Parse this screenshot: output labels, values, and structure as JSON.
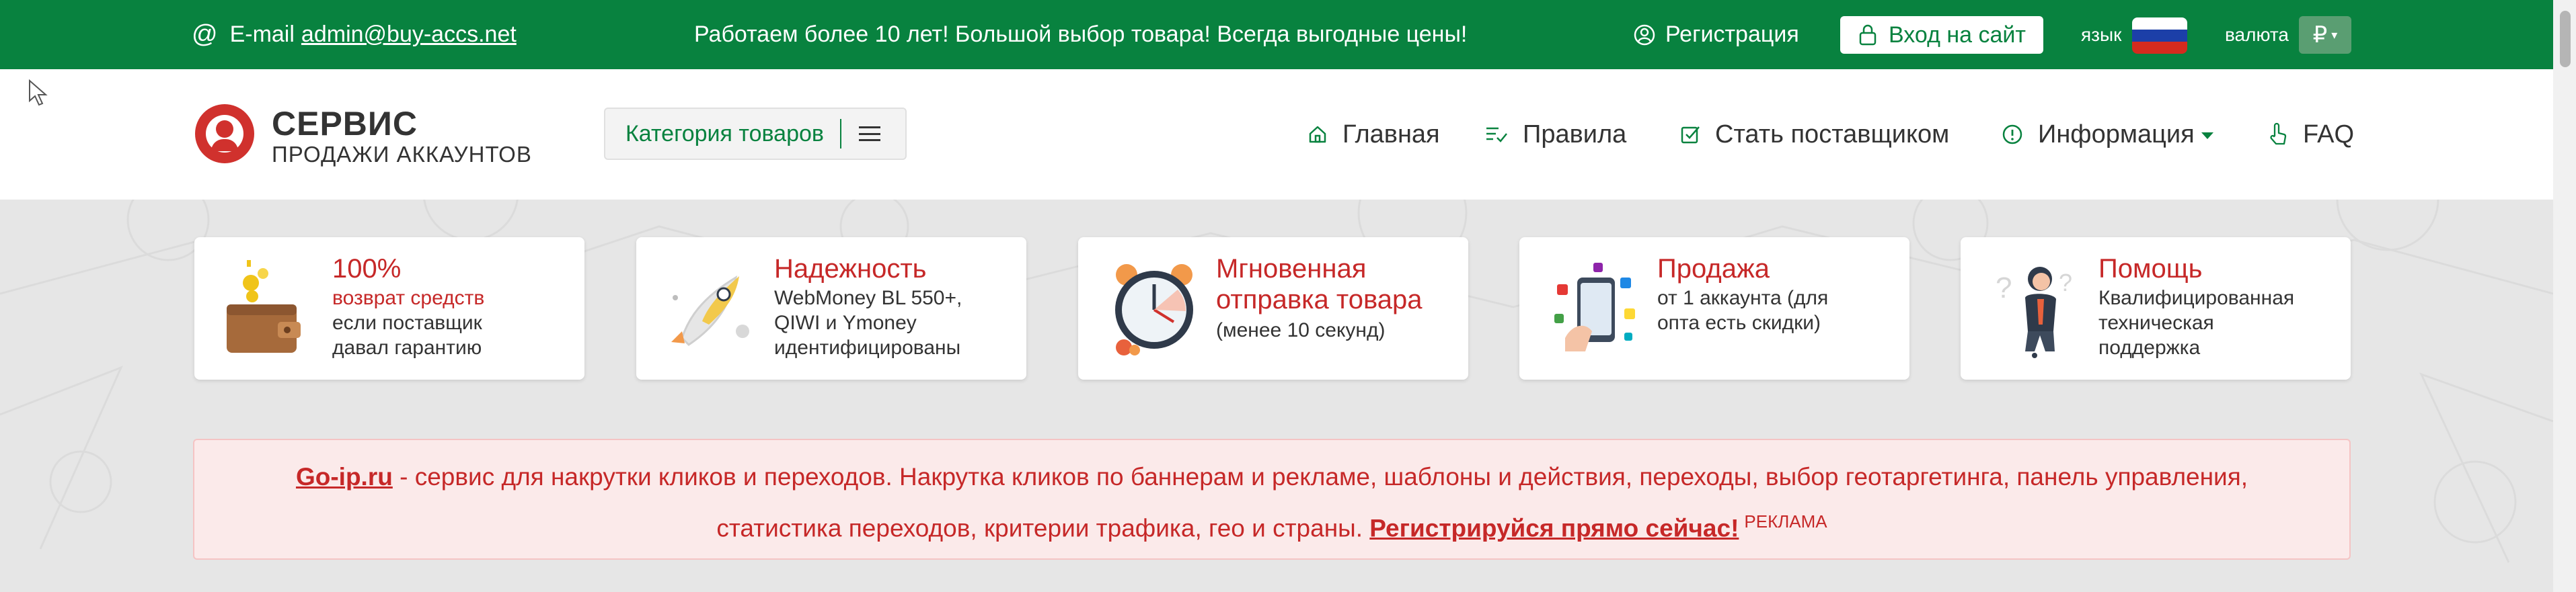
{
  "topbar": {
    "email_label": "E-mail",
    "email": "admin@buy-accs.net",
    "slogan": "Работаем более 10 лет! Большой выбор товара! Всегда выгодные цены!",
    "register": "Регистрация",
    "login": "Вход на сайт",
    "language_label": "язык",
    "currency_label": "валюта",
    "currency_symbol": "₽"
  },
  "header": {
    "logo_title": "СЕРВИС",
    "logo_subtitle": "ПРОДАЖИ АККАУНТОВ",
    "category_button": "Категория товаров",
    "nav": {
      "home": "Главная",
      "rules": "Правила",
      "supplier": "Стать поставщиком",
      "info": "Информация",
      "faq": "FAQ"
    }
  },
  "features": [
    {
      "title": "100%",
      "line1": "возврат средств",
      "line2": "если поставщик",
      "line3": "давал гарантию"
    },
    {
      "title": "Надежность",
      "line1": "WebMoney BL 550+,",
      "line2": "QIWI и Ymoney",
      "line3": "идентифицированы"
    },
    {
      "title_line1": "Мгновенная",
      "title_line2": "отправка товара",
      "line1": "(менее 10 секунд)"
    },
    {
      "title": "Продажа",
      "line1": "от 1 аккаунта (для",
      "line2": "опта есть скидки)"
    },
    {
      "title": "Помощь",
      "line1": "Квалифицированная",
      "line2": "техническая",
      "line3": "поддержка"
    }
  ],
  "ad": {
    "link": "Go-ip.ru",
    "text1": " - сервис для накрутки кликов и переходов. Накрутка кликов по баннерам и рекламе, шаблоны и действия, переходы, выбор геотаргетинга, панель управления,",
    "text2": "статистика переходов, критерии трафика, гео и страны. ",
    "cta": "Регистрируйся прямо сейчас!",
    "tag": "РЕКЛАМА"
  },
  "colors": {
    "brand_green": "#08823f",
    "accent_red": "#c62828",
    "ad_background": "#fbeaea"
  }
}
